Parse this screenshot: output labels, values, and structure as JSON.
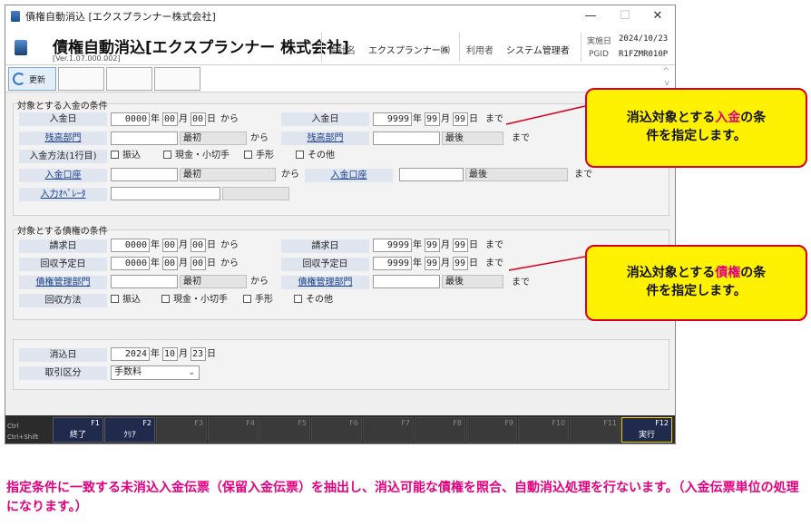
{
  "window": {
    "title": "債権自動消込 [エクスプランナー株式会社]",
    "min": "—",
    "max": "☐",
    "close": "✕"
  },
  "header": {
    "app_title": "債権自動消込[エクスプランナー 株式会社]",
    "version": "[Ver.1.07.000.002]",
    "company_label": "会社名",
    "company_value": "エクスプランナー㈱",
    "user_label": "利用者",
    "user_value": "システム管理者",
    "exec_date_label": "実施日",
    "exec_date_value": "2024/10/23",
    "pgid_label": "PGID",
    "pgid_value": "R1FZMR010P"
  },
  "toolbar": {
    "refresh_label": "更新",
    "up": "^",
    "down": "v"
  },
  "receipt": {
    "title": "対象とする入金の条件",
    "date_label": "入金日",
    "date_from": {
      "y": "0000",
      "m": "00",
      "d": "00"
    },
    "date_to": {
      "y": "9999",
      "m": "99",
      "d": "99"
    },
    "y_unit": "年",
    "m_unit": "月",
    "d_unit": "日",
    "from": "から",
    "to": "まで",
    "dept_label": "残高部門",
    "first": "最初",
    "last": "最後",
    "method_label": "入金方法(1行目)",
    "m_transfer": "振込",
    "m_cash": "現金・小切手",
    "m_bill": "手形",
    "m_other": "その他",
    "account_label": "入金口座",
    "operator_label": "入力ｵﾍﾟﾚｰﾀ"
  },
  "claim": {
    "title": "対象とする債権の条件",
    "bill_date_label": "請求日",
    "bill_from": {
      "y": "0000",
      "m": "00",
      "d": "00"
    },
    "bill_to": {
      "y": "9999",
      "m": "99",
      "d": "99"
    },
    "due_label": "回収予定日",
    "due_from": {
      "y": "0000",
      "m": "00",
      "d": "00"
    },
    "due_to": {
      "y": "9999",
      "m": "99",
      "d": "99"
    },
    "dept_label": "債権管理部門",
    "method_label": "回収方法"
  },
  "settle": {
    "date_label": "消込日",
    "date": {
      "y": "2024",
      "m": "10",
      "d": "23"
    },
    "type_label": "取引区分",
    "type_value": "手数料"
  },
  "fkeys": {
    "ctrl": "Ctrl",
    "ctrl_shift": "Ctrl+Shift",
    "keys": [
      {
        "num": "F1",
        "cap": "終了"
      },
      {
        "num": "F2",
        "cap": "ｸﾘｱ"
      },
      {
        "num": "F3",
        "cap": ""
      },
      {
        "num": "F4",
        "cap": ""
      },
      {
        "num": "F5",
        "cap": ""
      },
      {
        "num": "F6",
        "cap": ""
      },
      {
        "num": "F7",
        "cap": ""
      },
      {
        "num": "F8",
        "cap": ""
      },
      {
        "num": "F9",
        "cap": ""
      },
      {
        "num": "F10",
        "cap": ""
      },
      {
        "num": "F11",
        "cap": ""
      },
      {
        "num": "F12",
        "cap": "実行"
      }
    ]
  },
  "callout1": {
    "pre": "消込対象とする",
    "hl": "入金",
    "post": "の条",
    "line2": "件を指定します。"
  },
  "callout2": {
    "pre": "消込対象とする",
    "hl": "債権",
    "post": "の条",
    "line2": "件を指定します。"
  },
  "note": "指定条件に一致する未消込入金伝票（保留入金伝票）を抽出し、消込可能な債権を照合、自動消込処理を行ないます。（入金伝票単位の処理になります。）",
  "colors": {
    "callout_bg": "#fff200",
    "callout_border": "#d9001b",
    "highlight": "#e4007f"
  }
}
